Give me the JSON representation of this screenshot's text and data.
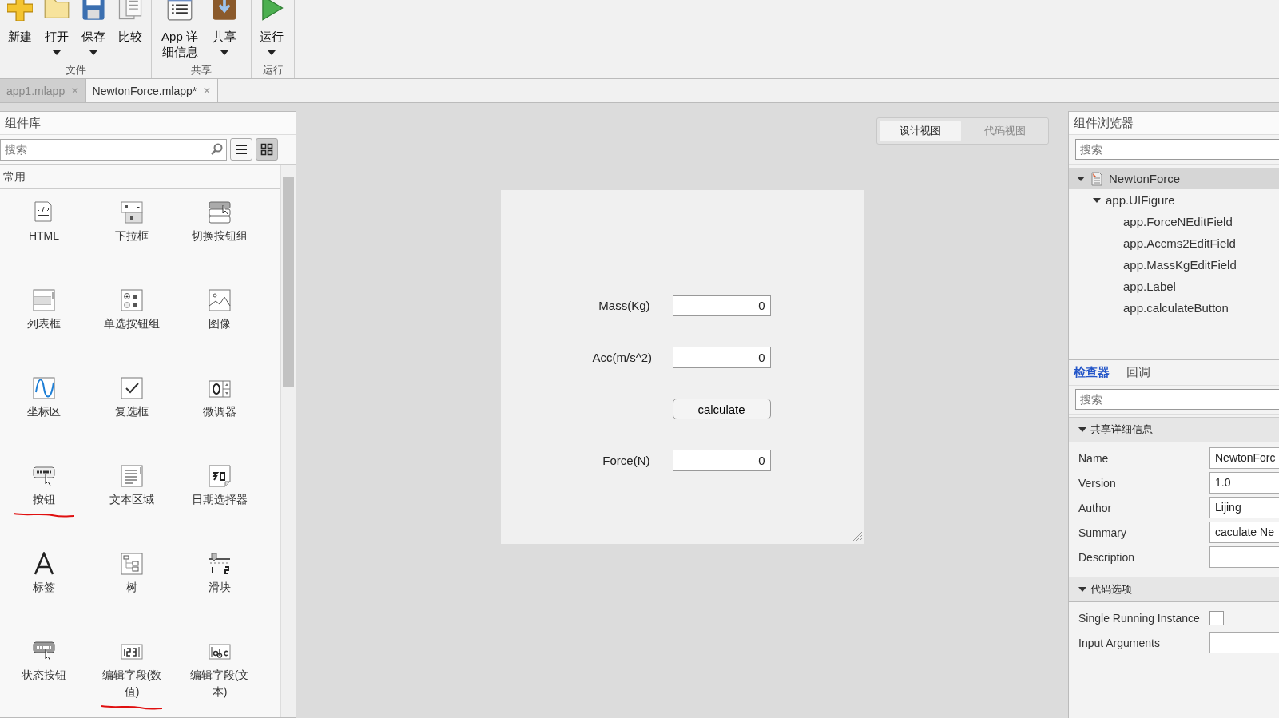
{
  "toolstrip": {
    "sections": [
      {
        "label": "文件",
        "buttons": [
          {
            "label": "新建",
            "has_menu": false
          },
          {
            "label": "打开",
            "has_menu": true
          },
          {
            "label": "保存",
            "has_menu": true
          },
          {
            "label": "比较",
            "has_menu": false
          }
        ]
      },
      {
        "label": "共享",
        "buttons": [
          {
            "label": "App 详细信息",
            "has_menu": false
          },
          {
            "label": "共享",
            "has_menu": true
          }
        ]
      },
      {
        "label": "运行",
        "buttons": [
          {
            "label": "运行",
            "has_menu": true
          }
        ]
      }
    ]
  },
  "doc_tabs": [
    {
      "label": "app1.mlapp",
      "close": "×",
      "selected": false
    },
    {
      "label": "NewtonForce.mlapp*",
      "close": "×",
      "selected": true
    }
  ],
  "library": {
    "title": "组件库",
    "search": {
      "placeholder": "搜索"
    },
    "views": [
      {
        "selected": false
      },
      {
        "selected": true
      }
    ],
    "category": "常用",
    "items": [
      {
        "label": "HTML",
        "underlined": false
      },
      {
        "label": "下拉框",
        "underlined": false
      },
      {
        "label": "切换按钮组",
        "underlined": false
      },
      {
        "label": "列表框",
        "underlined": false
      },
      {
        "label": "单选按钮组",
        "underlined": false
      },
      {
        "label": "图像",
        "underlined": false
      },
      {
        "label": "坐标区",
        "underlined": false
      },
      {
        "label": "复选框",
        "underlined": false
      },
      {
        "label": "微调器",
        "underlined": false
      },
      {
        "label": "按钮",
        "underlined": true
      },
      {
        "label": "文本区域",
        "underlined": false
      },
      {
        "label": "日期选择器",
        "underlined": false
      },
      {
        "label": "标签",
        "underlined": false
      },
      {
        "label": "树",
        "underlined": false
      },
      {
        "label": "滑块",
        "underlined": false
      },
      {
        "label": "状态按钮",
        "underlined": false
      },
      {
        "label": "编辑字段(数值)",
        "underlined": true
      },
      {
        "label": "编辑字段(文本)",
        "underlined": false
      }
    ]
  },
  "view_switch": [
    {
      "label": "设计视图",
      "selected": true
    },
    {
      "label": "代码视图",
      "selected": false
    }
  ],
  "figure": {
    "rows": [
      {
        "kind": "field",
        "label": "Mass(Kg)",
        "value": "0"
      },
      {
        "kind": "field",
        "label": "Acc(m/s^2)",
        "value": "0"
      },
      {
        "kind": "button",
        "label": "calculate"
      },
      {
        "kind": "field",
        "label": "Force(N)",
        "value": "0"
      }
    ]
  },
  "browser": {
    "title": "组件浏览器",
    "search": {
      "placeholder": "搜索"
    },
    "tree": [
      {
        "label": "NewtonForce",
        "selected": true,
        "expanded": true,
        "children": [
          {
            "label": "app.UIFigure",
            "selected": false,
            "expanded": true,
            "children": [
              {
                "label": "app.ForceNEditField",
                "selected": false
              },
              {
                "label": "app.Accms2EditField",
                "selected": false
              },
              {
                "label": "app.MassKgEditField",
                "selected": false
              },
              {
                "label": "app.Label",
                "selected": false
              },
              {
                "label": "app.calculateButton",
                "selected": false
              }
            ]
          }
        ]
      }
    ]
  },
  "inspector": {
    "tabs": [
      {
        "label": "检查器",
        "selected": true
      },
      {
        "label": "回调",
        "selected": false
      }
    ],
    "search": {
      "placeholder": "搜索"
    },
    "sections": [
      {
        "title": "共享详细信息",
        "expanded": true,
        "props": [
          {
            "kind": "text",
            "label": "Name",
            "value": "NewtonForc"
          },
          {
            "kind": "text",
            "label": "Version",
            "value": "1.0"
          },
          {
            "kind": "text",
            "label": "Author",
            "value": "Lijing"
          },
          {
            "kind": "text",
            "label": "Summary",
            "value": "caculate Ne"
          },
          {
            "kind": "text",
            "label": "Description"
          }
        ]
      },
      {
        "title": "代码选项",
        "expanded": true,
        "props": [
          {
            "kind": "checkbox",
            "label": "Single Running Instance",
            "checked": false
          },
          {
            "kind": "text",
            "label": "Input Arguments"
          }
        ]
      }
    ]
  }
}
